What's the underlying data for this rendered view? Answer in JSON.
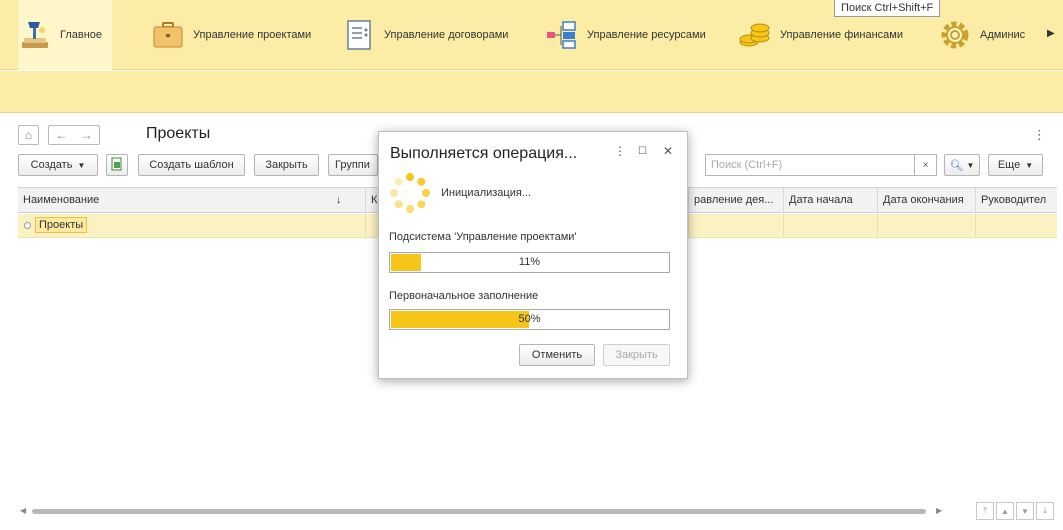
{
  "sections": [
    {
      "label": "Главное",
      "icon": "desk-lamp-icon"
    },
    {
      "label": "Управление проектами",
      "icon": "briefcase-icon"
    },
    {
      "label": "Управление договорами",
      "icon": "contract-document-icon"
    },
    {
      "label": "Управление ресурсами",
      "icon": "resource-tree-icon"
    },
    {
      "label": "Управление финансами",
      "icon": "coins-icon"
    },
    {
      "label": "Админис",
      "icon": "gear-icon"
    }
  ],
  "search_hint": "Поиск Ctrl+Shift+F",
  "form": {
    "title": "Проекты",
    "buttons": {
      "create": "Создать",
      "create_template": "Создать шаблон",
      "close": "Закрыть",
      "group": "Группи",
      "more": "Еще"
    },
    "search_placeholder": "Поиск (Ctrl+F)",
    "columns": [
      "Наименование",
      "Ко",
      "равление дея...",
      "Дата начала",
      "Дата окончания",
      "Руководител"
    ],
    "sort_arrow": "↓",
    "rows": [
      {
        "name": "Проекты"
      }
    ]
  },
  "dialog": {
    "title": "Выполняется операция...",
    "status": "Инициализация...",
    "tasks": [
      {
        "label": "Подсистема 'Управление проектами'",
        "progress": 11,
        "text": "11%"
      },
      {
        "label": "Первоначальное заполнение",
        "progress": 50,
        "text": "50%"
      }
    ],
    "cancel": "Отменить",
    "close": "Закрыть"
  },
  "colors": {
    "accent": "#f5c518",
    "panel": "#fbeda6"
  }
}
